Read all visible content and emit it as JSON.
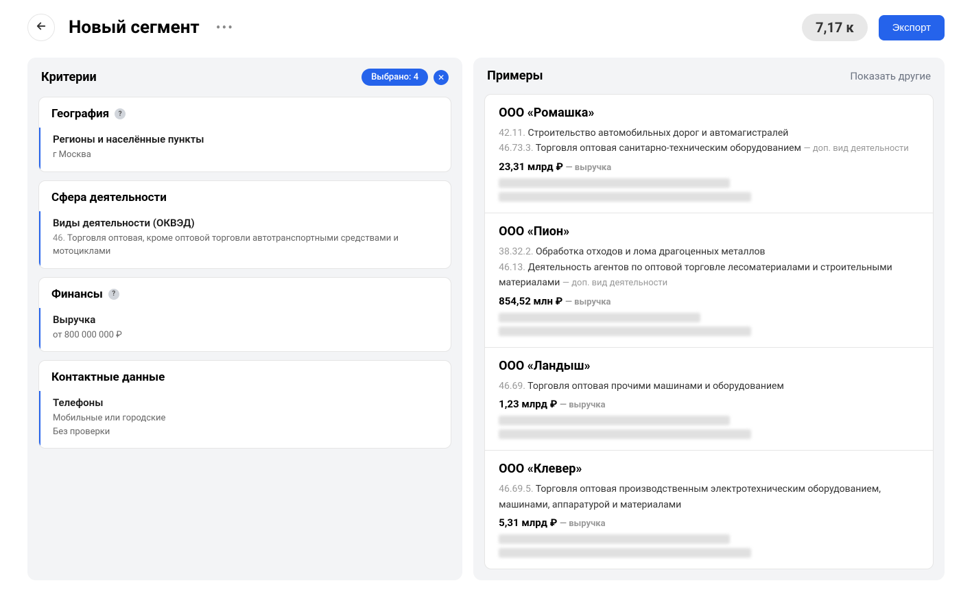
{
  "header": {
    "title": "Новый сегмент",
    "count": "7,17 к",
    "export_label": "Экспорт"
  },
  "criteria": {
    "title": "Критерии",
    "selected_label": "Выбрано: 4",
    "cards": [
      {
        "title": "География",
        "help": true,
        "subtitle": "Регионы и населённые пункты",
        "value": "г Москва"
      },
      {
        "title": "Сфера деятельности",
        "help": false,
        "subtitle": "Виды деятельности (ОКВЭД)",
        "code": "46.",
        "value": "Торговля оптовая, кроме оптовой торговли автотранспортными средствами и мотоциклами"
      },
      {
        "title": "Финансы",
        "help": true,
        "subtitle": "Выручка",
        "value": "от 800 000 000 ₽"
      },
      {
        "title": "Контактные данные",
        "help": false,
        "subtitle": "Телефоны",
        "value": "Мобильные или городские",
        "value2": "Без проверки"
      }
    ]
  },
  "examples": {
    "title": "Примеры",
    "show_other": "Показать другие",
    "revenue_label": "выручка",
    "add_type_label": "доп. вид деятельности",
    "items": [
      {
        "name": "ООО «Ромашка»",
        "activities": [
          {
            "code": "42.11.",
            "text": "Строительство автомобильных дорог и автомагистралей"
          },
          {
            "code": "46.73.3.",
            "text": "Торговля оптовая санитарно-техническим оборудованием",
            "additional": true
          }
        ],
        "revenue": "23,31 млрд ₽"
      },
      {
        "name": "ООО «Пион»",
        "activities": [
          {
            "code": "38.32.2.",
            "text": "Обработка отходов и лома драгоценных металлов"
          },
          {
            "code": "46.13.",
            "text": "Деятельность агентов по оптовой торговле лесоматериалами и строительными материалами",
            "additional": true
          }
        ],
        "revenue": "854,52 млн ₽"
      },
      {
        "name": "ООО «Ландыш»",
        "activities": [
          {
            "code": "46.69.",
            "text": "Торговля оптовая прочими машинами и оборудованием"
          }
        ],
        "revenue": "1,23 млрд ₽"
      },
      {
        "name": "ООО «Клевер»",
        "activities": [
          {
            "code": "46.69.5.",
            "text": "Торговля оптовая производственным электротехническим оборудованием, машинами, аппаратурой и материалами"
          }
        ],
        "revenue": "5,31 млрд ₽"
      }
    ]
  }
}
